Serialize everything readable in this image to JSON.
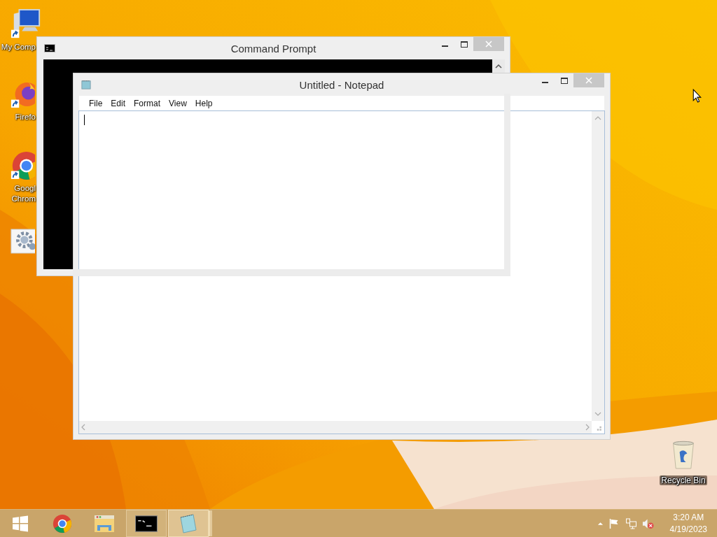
{
  "desktop_icons": [
    {
      "kind": "computer",
      "label_lines": [
        "My Comp"
      ]
    },
    {
      "kind": "firefox",
      "label_lines": [
        "Firefo"
      ]
    },
    {
      "kind": "chrome",
      "label_lines": [
        "Googl",
        "Chrom"
      ]
    },
    {
      "kind": "settings"
    }
  ],
  "command_prompt": {
    "title": "Command Prompt"
  },
  "notepad": {
    "title": "Untitled - Notepad",
    "menu": [
      "File",
      "Edit",
      "Format",
      "View",
      "Help"
    ]
  },
  "recycle_bin": {
    "label": "Recycle Bin"
  },
  "taskbar": {
    "items": [
      {
        "kind": "start",
        "running": false,
        "selected": false
      },
      {
        "kind": "chrome",
        "running": false,
        "selected": false
      },
      {
        "kind": "explorer",
        "running": false,
        "selected": false
      },
      {
        "kind": "cmd",
        "running": true,
        "selected": false
      },
      {
        "kind": "notepad",
        "running": true,
        "selected": true
      }
    ],
    "tray": {
      "volume_muted": true,
      "time": "3:20 AM",
      "date": "4/19/2023"
    }
  }
}
